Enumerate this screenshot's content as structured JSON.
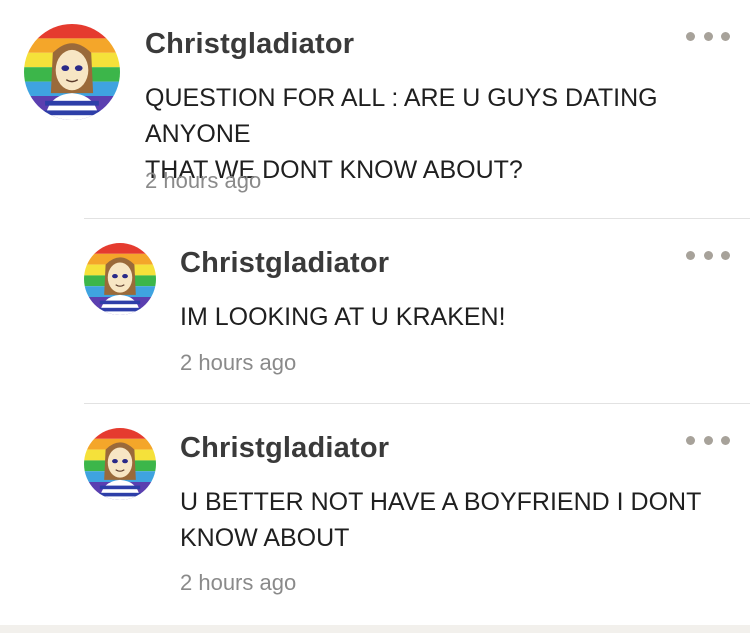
{
  "comments": [
    {
      "author": "Christgladiator",
      "text": "QUESTION FOR ALL : ARE U GUYS DATING ANYONE\nTHAT WE DONT KNOW ABOUT?",
      "time": "2 hours ago",
      "is_reply": false
    },
    {
      "author": "Christgladiator",
      "text": "IM LOOKING AT U KRAKEN!",
      "time": "2 hours ago",
      "is_reply": true
    },
    {
      "author": "Christgladiator",
      "text": "U BETTER NOT HAVE A BOYFRIEND I DONT\nKNOW ABOUT",
      "time": "2 hours ago",
      "is_reply": true
    }
  ],
  "icons": {
    "more": "more-options-icon",
    "avatar": "avatar-drawing"
  },
  "colors": {
    "author": "#3a3a3a",
    "text": "#1f1f1f",
    "time": "#8a8a8a",
    "dots": "#a7a29a",
    "divider": "#e2e2e2"
  }
}
